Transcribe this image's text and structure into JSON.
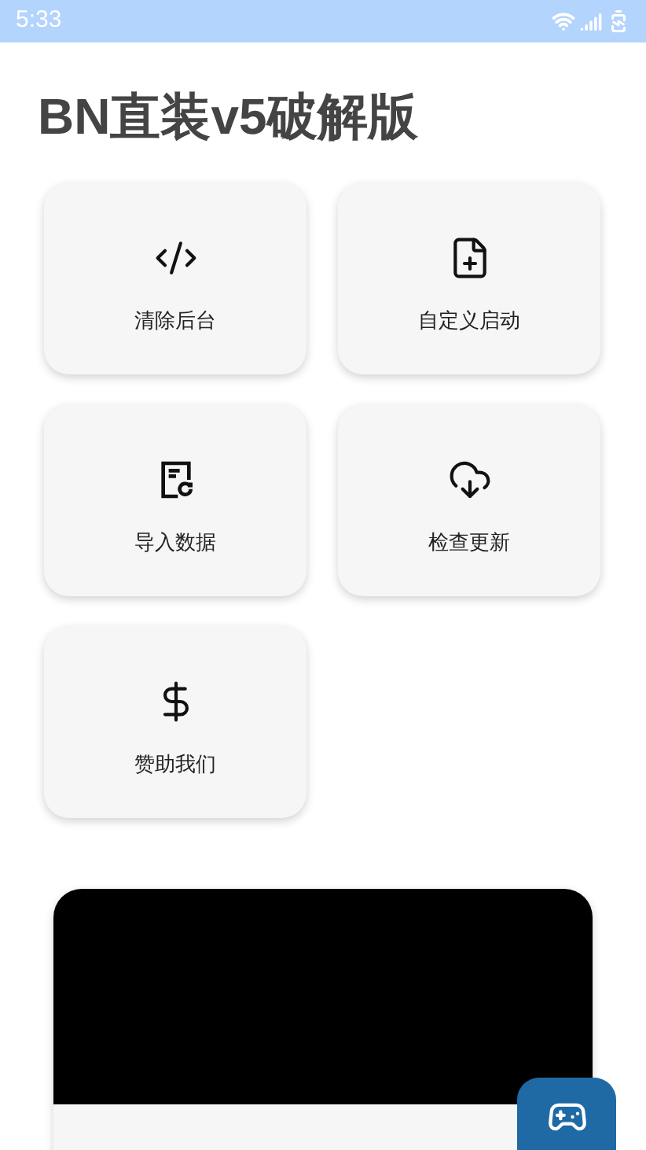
{
  "status_bar": {
    "time": "5:33"
  },
  "title": "BN直装v5破解版",
  "actions": [
    {
      "label": "清除后台"
    },
    {
      "label": "自定义启动"
    },
    {
      "label": "导入数据"
    },
    {
      "label": "检查更新"
    },
    {
      "label": "赞助我们"
    }
  ]
}
